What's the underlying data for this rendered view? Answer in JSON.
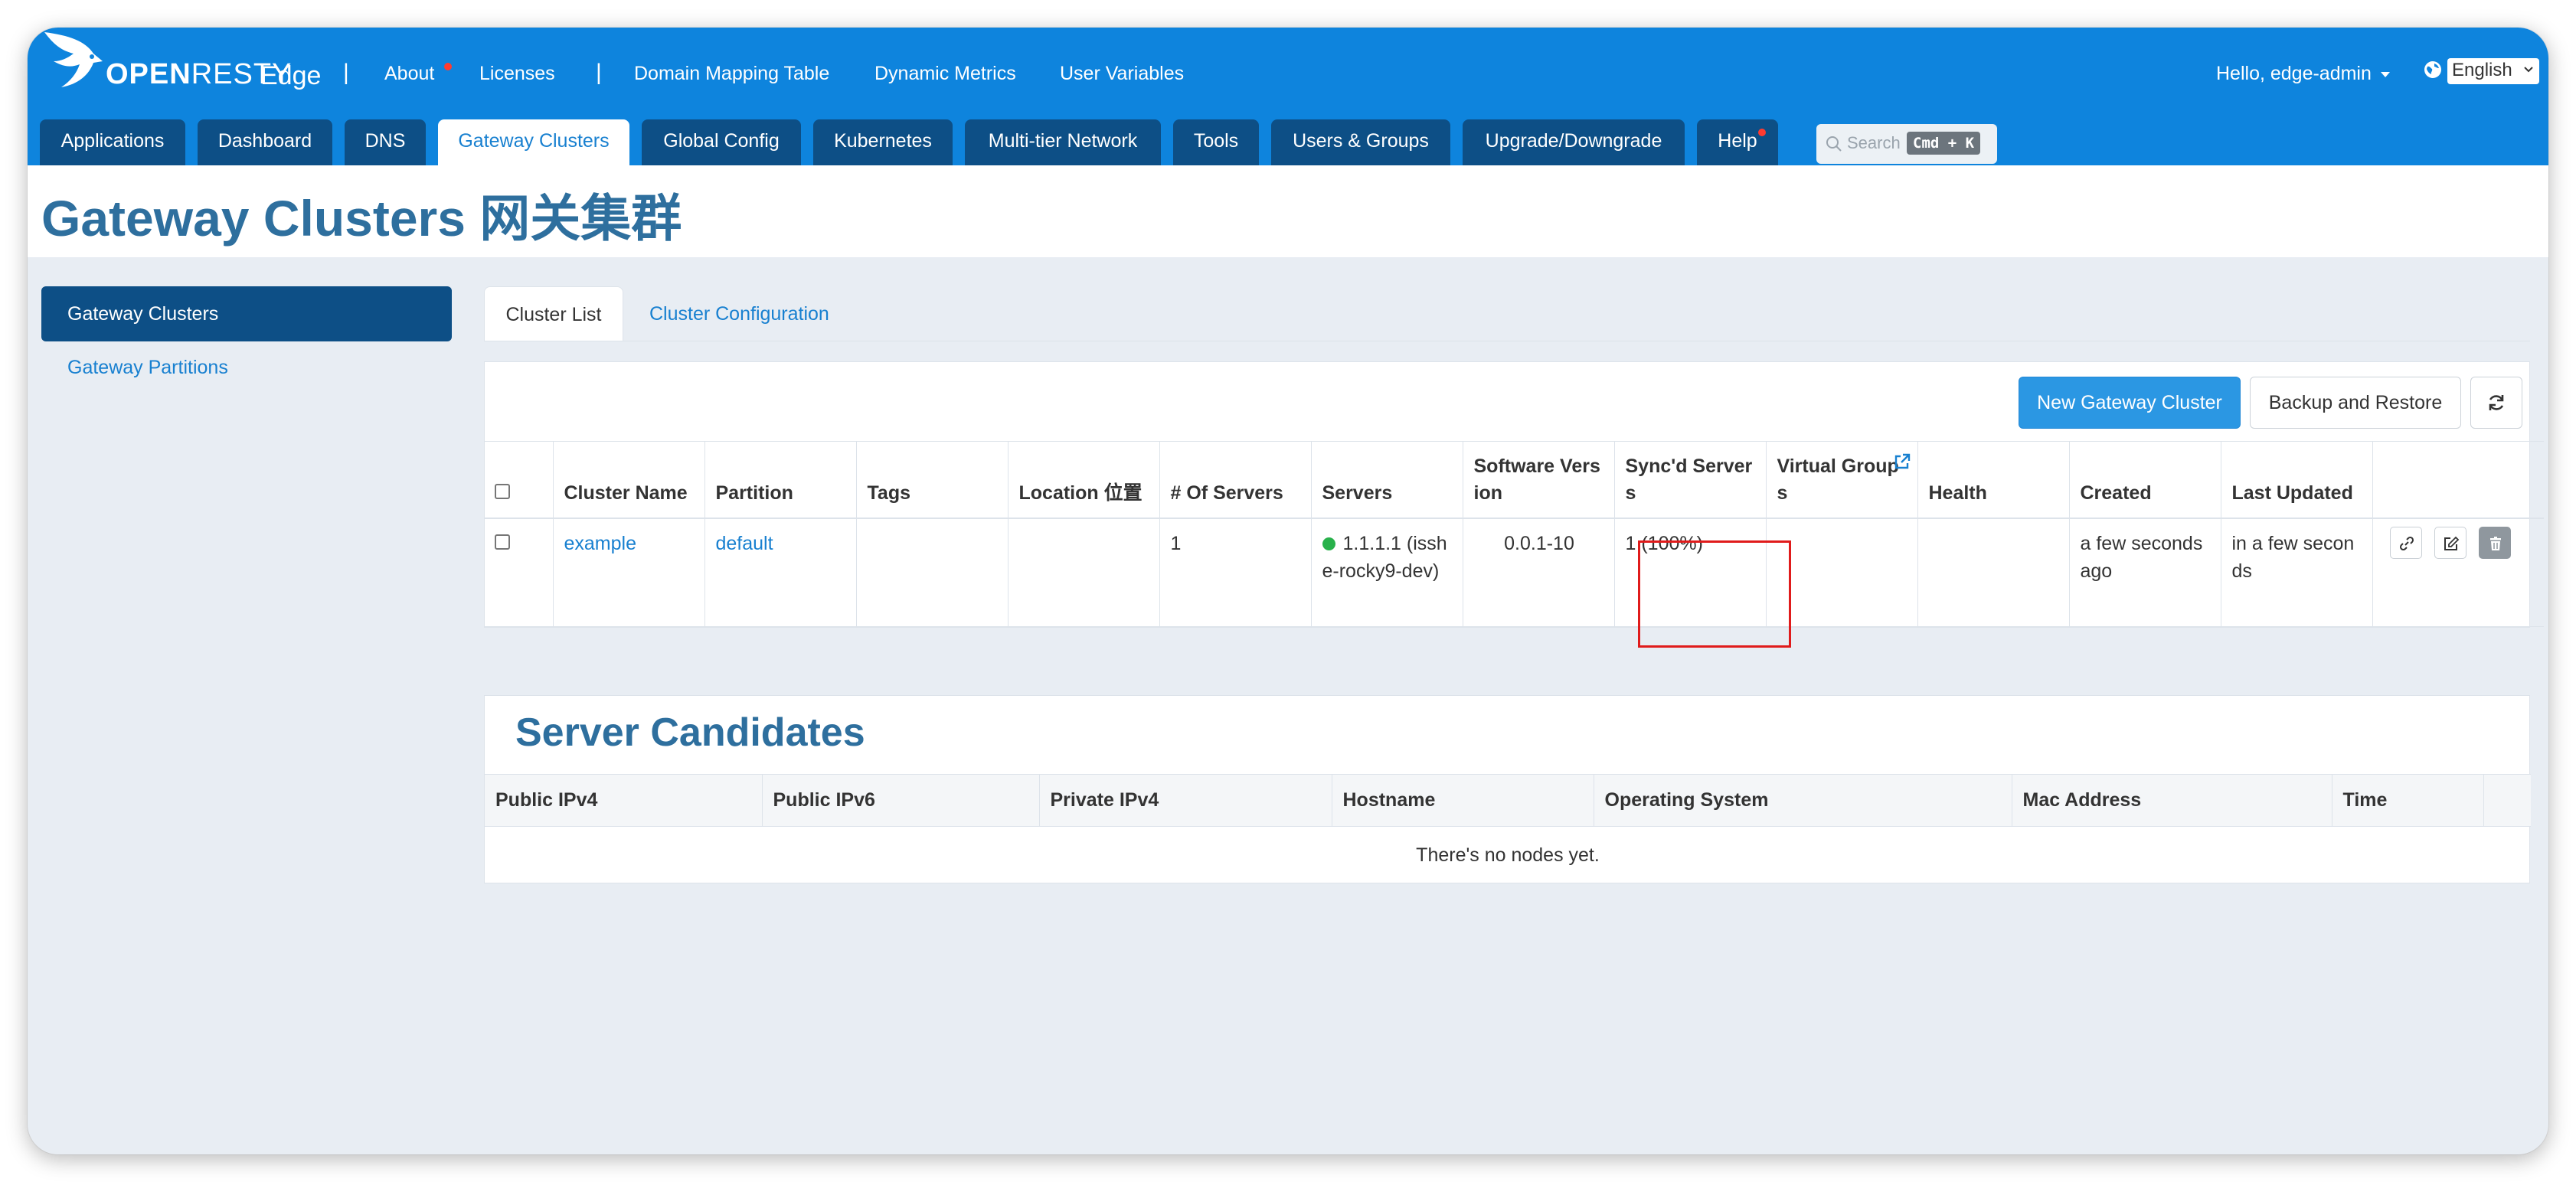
{
  "app": {
    "brand_bold": "OPEN",
    "brand_light": "RESTY",
    "product": "Edge"
  },
  "topnav": {
    "about": "About",
    "licenses": "Licenses",
    "domain_mapping": "Domain Mapping Table",
    "dynamic_metrics": "Dynamic Metrics",
    "user_variables": "User Variables",
    "separator": "|",
    "user_greeting": "Hello, edge-admin",
    "language": "English"
  },
  "tabs": [
    {
      "label": "Applications"
    },
    {
      "label": "Dashboard"
    },
    {
      "label": "DNS"
    },
    {
      "label": "Gateway Clusters",
      "active": true
    },
    {
      "label": "Global Config"
    },
    {
      "label": "Kubernetes"
    },
    {
      "label": "Multi-tier Network"
    },
    {
      "label": "Tools"
    },
    {
      "label": "Users & Groups"
    },
    {
      "label": "Upgrade/Downgrade"
    },
    {
      "label": "Help"
    }
  ],
  "search": {
    "placeholder": "Search",
    "shortcut": "Cmd + K"
  },
  "page_title": "Gateway Clusters  网关集群",
  "sidebar": {
    "items": [
      {
        "label": "Gateway Clusters",
        "active": true
      },
      {
        "label": "Gateway Partitions"
      }
    ]
  },
  "inner_tabs": {
    "cluster_list": "Cluster List",
    "cluster_configuration": "Cluster Configuration"
  },
  "toolbar": {
    "new_cluster": "New Gateway Cluster",
    "backup_restore": "Backup and Restore"
  },
  "cluster_table": {
    "headers": {
      "name": "Cluster Name",
      "partition": "Partition",
      "tags": "Tags",
      "location": "Location 位置",
      "num_servers": "# Of Servers",
      "servers": "Servers",
      "software_version": "Software Version",
      "synced": "Sync'd Servers",
      "virtual_groups": "Virtual Groups",
      "health": "Health",
      "created": "Created",
      "last_updated": "Last Updated"
    },
    "rows": [
      {
        "name": "example",
        "partition": "default",
        "tags": "",
        "location": "",
        "num_servers": "1",
        "server_ip": "1.1.1.1",
        "server_host": "(isshe-rocky9-dev)",
        "software_version": "0.0.1-10",
        "synced": "1 (100%)",
        "virtual_groups": "",
        "health": "",
        "created": "a few seconds ago",
        "last_updated": "in a few seconds"
      }
    ]
  },
  "server_candidates": {
    "title": "Server Candidates",
    "headers": {
      "public_ipv4": "Public IPv4",
      "public_ipv6": "Public IPv6",
      "private_ipv4": "Private IPv4",
      "hostname": "Hostname",
      "os": "Operating System",
      "mac": "Mac Address",
      "time": "Time"
    },
    "empty_text": "There's no nodes yet."
  },
  "colors": {
    "navbar": "#0e84dd",
    "tab_dark": "#0d4f86",
    "title": "#2e6f9e",
    "link": "#1880d0",
    "primary_button": "#2b97e3",
    "status_ok": "#28b14b",
    "highlight": "#e01b1b"
  }
}
